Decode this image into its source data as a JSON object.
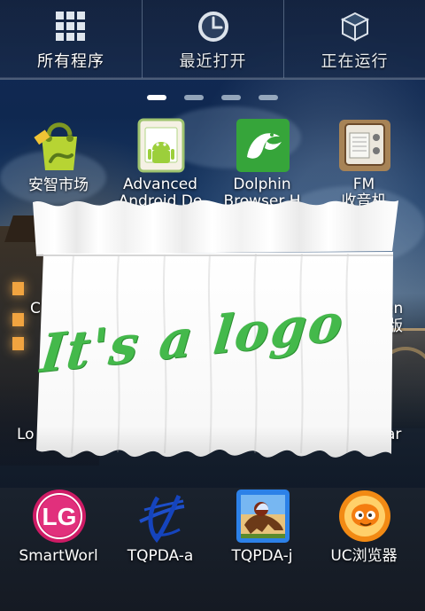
{
  "tabs": [
    {
      "label": "所有程序",
      "icon": "grid-icon"
    },
    {
      "label": "最近打开",
      "icon": "clock-icon"
    },
    {
      "label": "正在运行",
      "icon": "box-icon"
    }
  ],
  "page_indicator": {
    "count": 4,
    "active": 0
  },
  "apps": [
    {
      "label": "安智市场",
      "icon": "anzhi-market-icon"
    },
    {
      "label": "Advanced\nAndroid De",
      "icon": "android-device-icon"
    },
    {
      "label": "Dolphin\nBrowser H",
      "icon": "dolphin-browser-icon"
    },
    {
      "label": "FM\n收音机",
      "icon": "fm-radio-icon"
    },
    {
      "label": "SmartWorl",
      "icon": "lg-logo-icon"
    },
    {
      "label": "TQPDA-a",
      "icon": "tqpda-a-icon"
    },
    {
      "label": "TQPDA-j",
      "icon": "tqpda-j-icon"
    },
    {
      "label": "UC浏览器",
      "icon": "uc-browser-icon"
    }
  ],
  "partial_labels": {
    "left_mid": "C",
    "right_mid_top": "en",
    "right_mid_bottom": "版",
    "left_lower": "Lo",
    "right_lower": "ar"
  },
  "widget": {
    "logo_text": "It's a logo",
    "colors": {
      "curtain": "#ffffff",
      "logo_green": "#44b94b"
    }
  },
  "colors": {
    "tab_bar": "#172c52",
    "text": "#ffffff",
    "wallpaper_dark": "#151a23"
  }
}
